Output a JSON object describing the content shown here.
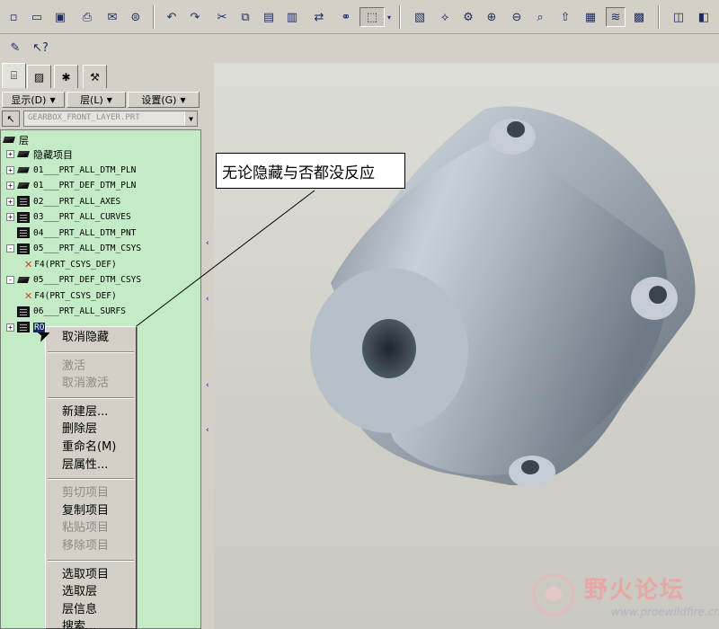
{
  "toolbar": {
    "icons": [
      "new-icon",
      "open-icon",
      "save-icon",
      "print-icon",
      "send-mail-icon",
      "send-icon",
      "undo-icon",
      "redo-icon",
      "cut-icon",
      "copy-icon",
      "paste-icon",
      "paste-special-icon",
      "regenerate-icon",
      "find-icon",
      "select-box-icon",
      "repaint-icon",
      "spin-center-icon",
      "orient-icon",
      "zoom-in-icon",
      "zoom-out-icon",
      "refit-icon",
      "view-manager-icon",
      "named-views-icon",
      "layers-icon",
      "view-display-icon",
      "shading-icon"
    ],
    "row2_icons": [
      "context-help-icon",
      "whats-this-icon"
    ]
  },
  "left_panel": {
    "tabs": [
      "model-tree-tab",
      "folder-browser-tab",
      "favorites-tab",
      "connections-tab"
    ],
    "menus": [
      {
        "label": "显示(D)"
      },
      {
        "label": "层(L)"
      },
      {
        "label": "设置(G)"
      }
    ],
    "active_model": "GEARBOX_FRONT_LAYER.PRT"
  },
  "layer_tree": {
    "root_label": "层",
    "rows": [
      {
        "expander": "+",
        "icon": "plane",
        "label": "隐藏项目",
        "cn": true
      },
      {
        "expander": "+",
        "icon": "plane",
        "label": "01___PRT_ALL_DTM_PLN"
      },
      {
        "expander": "+",
        "icon": "plane",
        "label": "01___PRT_DEF_DTM_PLN"
      },
      {
        "expander": "+",
        "icon": "stack",
        "label": "02___PRT_ALL_AXES"
      },
      {
        "expander": "+",
        "icon": "stack",
        "label": "03___PRT_ALL_CURVES"
      },
      {
        "expander": "",
        "icon": "stack",
        "label": "04___PRT_ALL_DTM_PNT"
      },
      {
        "expander": "-",
        "icon": "stack",
        "label": "05___PRT_ALL_DTM_CSYS"
      },
      {
        "expander": "",
        "icon": "csys",
        "label": "F4(PRT_CSYS_DEF)",
        "child": true
      },
      {
        "expander": "-",
        "icon": "plane",
        "label": "05___PRT_DEF_DTM_CSYS"
      },
      {
        "expander": "",
        "icon": "csys",
        "label": "F4(PRT_CSYS_DEF)",
        "child": true
      },
      {
        "expander": "",
        "icon": "stack",
        "label": "06___PRT_ALL_SURFS"
      },
      {
        "expander": "+",
        "icon": "stack",
        "label": "RO",
        "selected": true
      }
    ]
  },
  "callout": {
    "text": "无论隐藏与否都没反应"
  },
  "context_menu": {
    "groups": [
      [
        {
          "label": "取消隐藏",
          "enabled": true,
          "highlight": true
        }
      ],
      [
        {
          "label": "激活",
          "enabled": false
        },
        {
          "label": "取消激活",
          "enabled": false
        }
      ],
      [
        {
          "label": "新建层...",
          "enabled": true
        },
        {
          "label": "删除层",
          "enabled": true
        },
        {
          "label": "重命名(M)",
          "enabled": true
        },
        {
          "label": "层属性...",
          "enabled": true
        }
      ],
      [
        {
          "label": "剪切项目",
          "enabled": false
        },
        {
          "label": "复制项目",
          "enabled": true
        },
        {
          "label": "粘贴项目",
          "enabled": false
        },
        {
          "label": "移除项目",
          "enabled": false
        }
      ],
      [
        {
          "label": "选取项目",
          "enabled": true
        },
        {
          "label": "选取层",
          "enabled": true
        },
        {
          "label": "层信息",
          "enabled": true
        },
        {
          "label": "搜索...",
          "enabled": true
        }
      ]
    ]
  },
  "watermark": {
    "title": "野火论坛",
    "url": "www.proewildfire.cn"
  },
  "colors": {
    "tree_bg": "#c2ebc6",
    "viewport_bg": "#d2d1c9",
    "selection": "#0a246a",
    "part_shade": "#9aa6b2"
  }
}
